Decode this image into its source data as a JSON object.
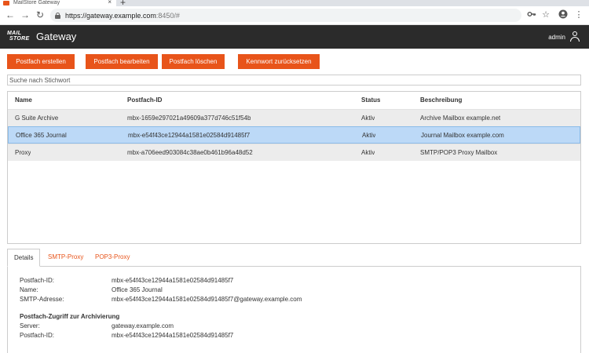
{
  "browser": {
    "tab_title": "MailStore Gateway",
    "tab_close": "×",
    "new_tab": "+",
    "back": "←",
    "forward": "→",
    "reload": "↻",
    "url_main": "https://gateway.example.com",
    "url_rest": ":8450/#"
  },
  "app": {
    "logo_line1": "MAIL",
    "logo_line2": "STORE",
    "title": "Gateway",
    "user": "admin"
  },
  "toolbar": {
    "create": "Postfach erstellen",
    "edit": "Postfach bearbeiten",
    "delete": "Postfach löschen",
    "reset_password": "Kennwort zurücksetzen"
  },
  "search": {
    "placeholder": "Suche nach Stichwort"
  },
  "table": {
    "headers": [
      "Name",
      "Postfach-ID",
      "Status",
      "Beschreibung"
    ],
    "rows": [
      {
        "name": "G Suite Archive",
        "id": "mbx-1659e297021a49609a377d746c51f54b",
        "status": "Aktiv",
        "description": "Archive Mailbox example.net"
      },
      {
        "name": "Office 365 Journal",
        "id": "mbx-e54f43ce12944a1581e02584d91485f7",
        "status": "Aktiv",
        "description": "Journal Mailbox example.com"
      },
      {
        "name": "Proxy",
        "id": "mbx-a706eed903084c38ae0b461b96a48d52",
        "status": "Aktiv",
        "description": "SMTP/POP3 Proxy Mailbox"
      }
    ]
  },
  "details": {
    "tabs": [
      "Details",
      "SMTP-Proxy",
      "POP3-Proxy"
    ],
    "fields": [
      {
        "label": "Postfach-ID:",
        "value": "mbx-e54f43ce12944a1581e02584d91485f7"
      },
      {
        "label": "Name:",
        "value": "Office 365 Journal"
      },
      {
        "label": "SMTP-Adresse:",
        "value": "mbx-e54f43ce12944a1581e02584d91485f7@gateway.example.com"
      }
    ],
    "section_title": "Postfach-Zugriff zur Archivierung",
    "access_fields": [
      {
        "label": "Server:",
        "value": "gateway.example.com"
      },
      {
        "label": "Postfach-ID:",
        "value": "mbx-e54f43ce12944a1581e02584d91485f7"
      }
    ]
  }
}
